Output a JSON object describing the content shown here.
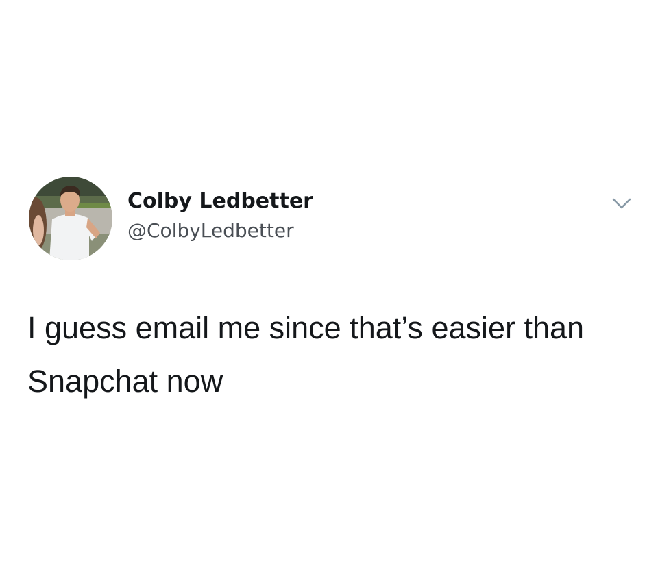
{
  "tweet": {
    "display_name": "Colby Ledbetter",
    "handle": "@ColbyLedbetter",
    "text_line_1": "I guess email me since that’s easier than",
    "text_line_2": "Snapchat now"
  },
  "icons": {
    "avatar": "profile-photo",
    "menu": "chevron-down-icon"
  },
  "colors": {
    "background": "#ffffff",
    "name": "#14171a",
    "handle": "#4a4f55",
    "chevron": "#8899a6"
  }
}
